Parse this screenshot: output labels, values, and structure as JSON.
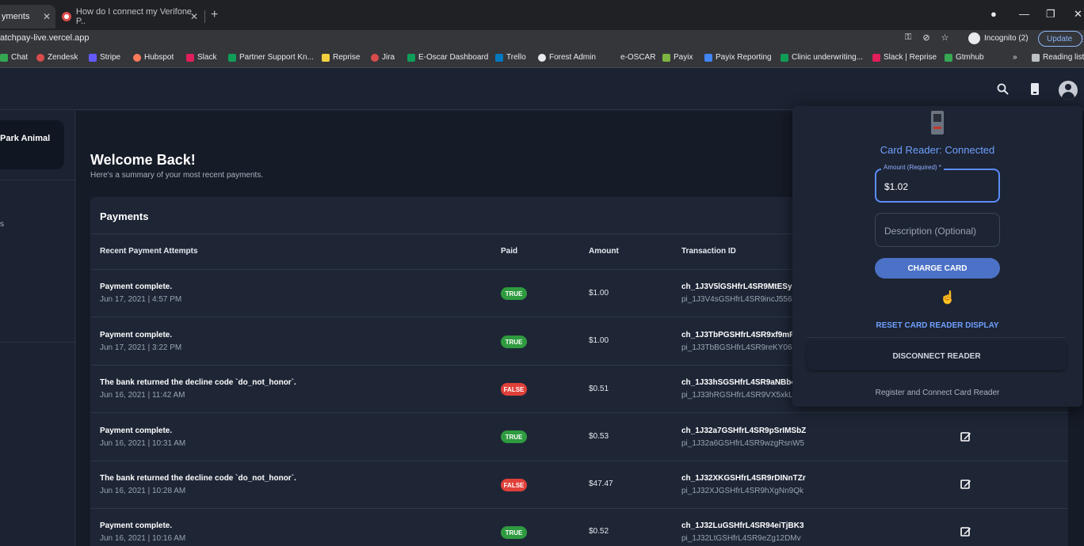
{
  "browser": {
    "tabs": [
      {
        "label": "yments",
        "active": true
      },
      {
        "label": "How do I connect my Verifone P..",
        "active": false
      }
    ],
    "url": "atchpay-live.vercel.app",
    "incognito_label": "Incognito (2)",
    "update_label": "Update",
    "bookmarks": [
      "Chat",
      "Zendesk",
      "Stripe",
      "Hubspot",
      "Slack",
      "Partner Support Kn...",
      "Reprise",
      "Jira",
      "E-Oscar Dashboard",
      "Trello",
      "Forest Admin",
      "e-OSCAR",
      "Payix",
      "Payix Reporting",
      "Clinic underwriting...",
      "Slack | Reprise",
      "Gtmhub",
      "»",
      "Reading list"
    ]
  },
  "sidebar": {
    "org_name": "Park Animal",
    "fragment": "s"
  },
  "main": {
    "welcome_title": "Welcome Back!",
    "welcome_sub": "Here's a summary of your most recent payments.",
    "payments_title": "Payments",
    "columns": [
      "Recent Payment Attempts",
      "Paid",
      "Amount",
      "Transaction ID"
    ],
    "rows": [
      {
        "status": "Payment complete.",
        "date": "Jun 17, 2021 | 4:57 PM",
        "paid": "TRUE",
        "amount": "$1.00",
        "tx1": "ch_1J3V5lGSHfrL4SR9MtESy",
        "tx2": "pi_1J3V4sGSHfrL4SR9incJ556"
      },
      {
        "status": "Payment complete.",
        "date": "Jun 17, 2021 | 3:22 PM",
        "paid": "TRUE",
        "amount": "$1.00",
        "tx1": "ch_1J3TbPGSHfrL4SR9xf9mF",
        "tx2": "pi_1J3TbBGSHfrL4SR9reKY06"
      },
      {
        "status": "The bank returned the decline code `do_not_honor`.",
        "date": "Jun 16, 2021 | 11:42 AM",
        "paid": "FALSE",
        "amount": "$0.51",
        "tx1": "ch_1J33hSGSHfrL4SR9aNBb4",
        "tx2": "pi_1J33hRGSHfrL4SR9VX5xkL"
      },
      {
        "status": "Payment complete.",
        "date": "Jun 16, 2021 | 10:31 AM",
        "paid": "TRUE",
        "amount": "$0.53",
        "tx1": "ch_1J32a7GSHfrL4SR9pSrIMSbZ",
        "tx2": "pi_1J32a6GSHfrL4SR9wzgRsnW5"
      },
      {
        "status": "The bank returned the decline code `do_not_honor`.",
        "date": "Jun 16, 2021 | 10:28 AM",
        "paid": "FALSE",
        "amount": "$47.47",
        "tx1": "ch_1J32XKGSHfrL4SR9rDINnTZr",
        "tx2": "pi_1J32XJGSHfrL4SR9hXgNn9Qk"
      },
      {
        "status": "Payment complete.",
        "date": "Jun 16, 2021 | 10:16 AM",
        "paid": "TRUE",
        "amount": "$0.52",
        "tx1": "ch_1J32LuGSHfrL4SR94eiTjBK3",
        "tx2": "pi_1J32LtGSHfrL4SR9eZg12DMv"
      }
    ]
  },
  "reader": {
    "status": "Card Reader: Connected",
    "amount_label": "Amount (Required) *",
    "amount_value": "$1.02",
    "description_placeholder": "Description (Optional)",
    "charge_label": "CHARGE CARD",
    "reset_label": "RESET CARD READER DISPLAY",
    "disconnect_label": "DISCONNECT READER",
    "register_label": "Register and Connect Card Reader"
  },
  "colors": {
    "accent": "#4c72c7",
    "status_true": "#2e9b3f",
    "status_false": "#e0403a",
    "link": "#6fa0ff"
  }
}
